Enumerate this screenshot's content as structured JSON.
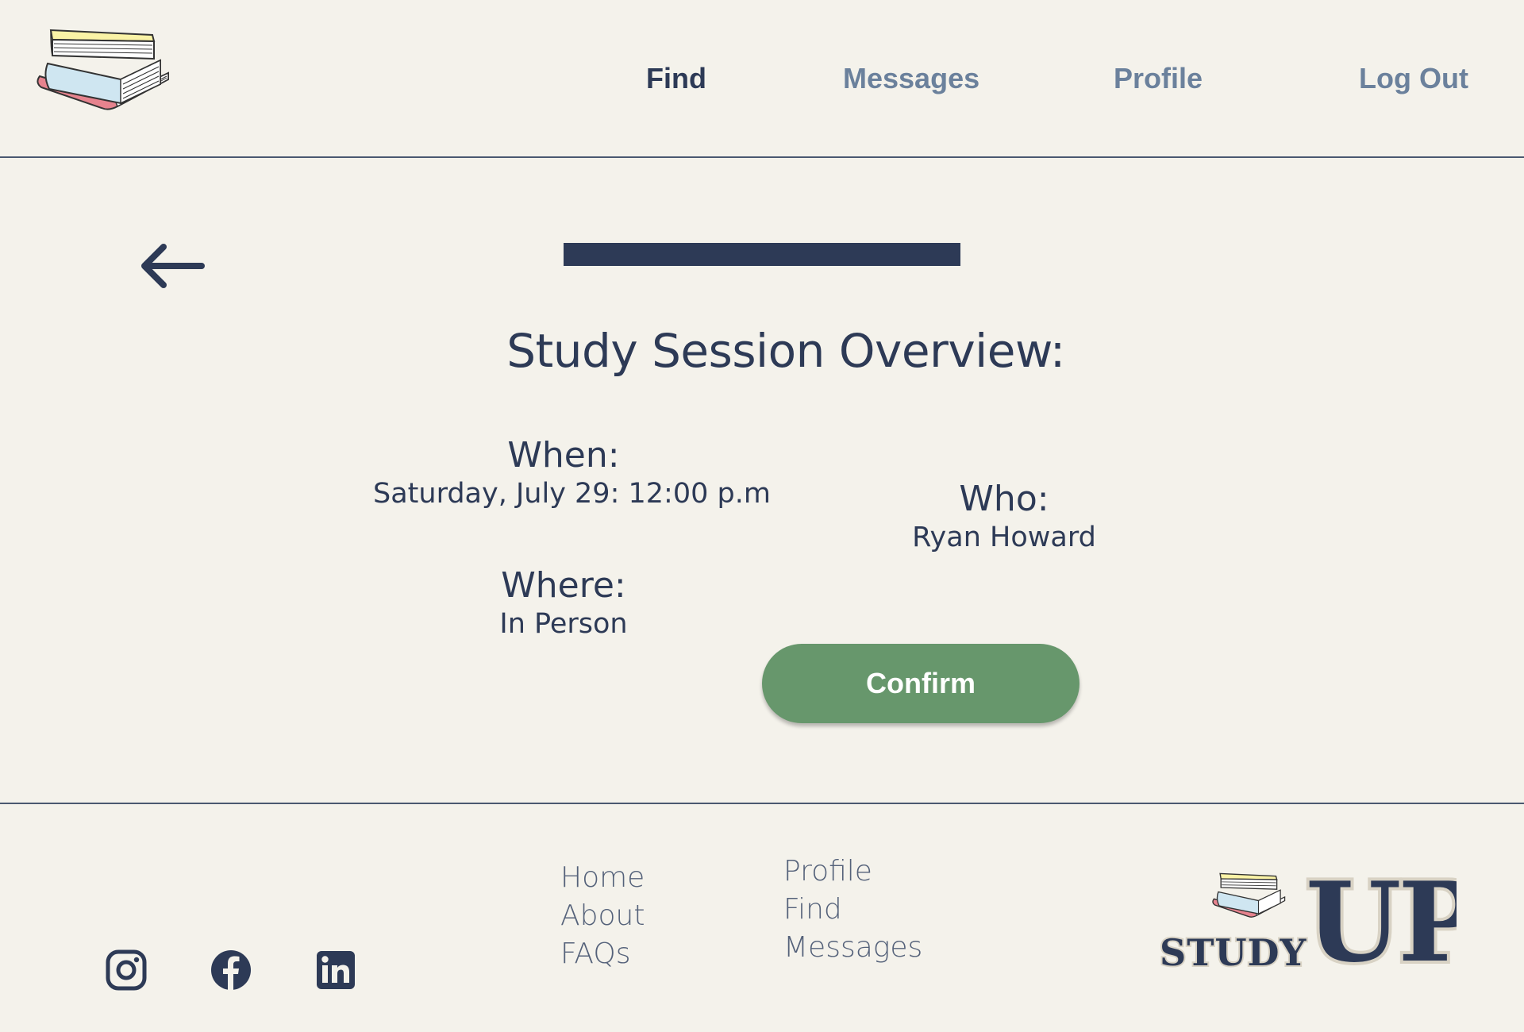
{
  "header": {
    "nav": [
      {
        "label": "Find",
        "active": true
      },
      {
        "label": "Messages",
        "active": false
      },
      {
        "label": "Profile",
        "active": false
      },
      {
        "label": "Log Out",
        "active": false
      }
    ]
  },
  "main": {
    "progress": 1.0,
    "title": "Study Session Overview:",
    "when": {
      "label": "When:",
      "value": "Saturday, July 29: 12:00 p.m"
    },
    "where": {
      "label": "Where:",
      "value": "In Person"
    },
    "who": {
      "label": "Who:",
      "value": "Ryan Howard"
    },
    "confirm_label": "Confirm"
  },
  "footer": {
    "social": [
      "instagram-icon",
      "facebook-icon",
      "linkedin-icon"
    ],
    "col1": [
      "Home",
      "About",
      "FAQs"
    ],
    "col2": [
      "Profile",
      "Find",
      "Messages"
    ],
    "brand": {
      "word1": "STUDY",
      "word2": "UP"
    }
  },
  "colors": {
    "background": "#f4f2eb",
    "navy": "#2d3a56",
    "nav_inactive": "#6b819c",
    "confirm": "#67976c"
  }
}
